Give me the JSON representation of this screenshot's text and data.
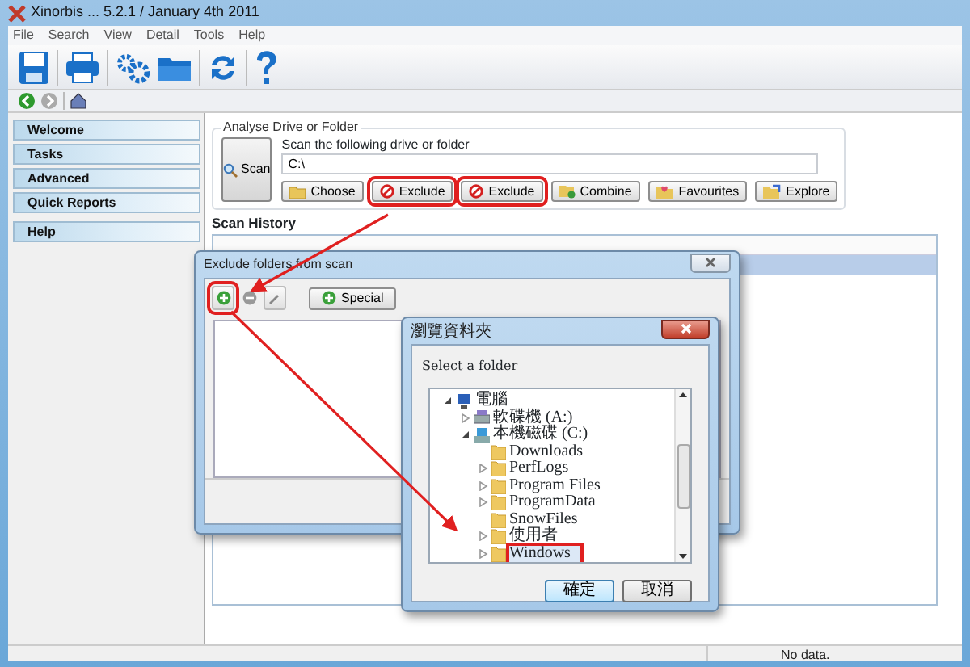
{
  "window": {
    "title": "Xinorbis ... 5.2.1 / January 4th 2011"
  },
  "menu": [
    {
      "label": "File"
    },
    {
      "label": "Search"
    },
    {
      "label": "View"
    },
    {
      "label": "Detail"
    },
    {
      "label": "Tools"
    },
    {
      "label": "Help"
    }
  ],
  "sidebar": {
    "items": [
      {
        "label": "Welcome"
      },
      {
        "label": "Tasks"
      },
      {
        "label": "Advanced"
      },
      {
        "label": "Quick Reports"
      },
      {
        "label": "Help"
      }
    ]
  },
  "analyse": {
    "title": "Analyse Drive or Folder",
    "scan_button": "Scan",
    "path_label": "Scan the following drive or folder",
    "path_value": "C:\\",
    "buttons": [
      {
        "label": "Choose",
        "kind": "folder",
        "highlighted": false
      },
      {
        "label": "Exclude",
        "kind": "exclude",
        "highlighted": true
      },
      {
        "label": "Exclude",
        "kind": "exclude",
        "highlighted": true
      },
      {
        "label": "Combine",
        "kind": "combine",
        "highlighted": false
      },
      {
        "label": "Favourites",
        "kind": "favourites",
        "highlighted": false
      },
      {
        "label": "Explore",
        "kind": "explore",
        "highlighted": false
      }
    ]
  },
  "scan_history": {
    "title": "Scan History"
  },
  "exclude_dialog": {
    "title": "Exclude folders from scan",
    "add_highlighted": true,
    "special_button": "Special"
  },
  "folder_dialog": {
    "title": "瀏覽資料夾",
    "prompt": "Select a folder",
    "tree": [
      {
        "label": "電腦",
        "kind": "computer",
        "expandable": true,
        "expanded": true,
        "selected": false,
        "children": [
          {
            "label": "軟碟機 (A:)",
            "kind": "floppy",
            "expandable": true,
            "expanded": false,
            "selected": false
          },
          {
            "label": "本機磁碟 (C:)",
            "kind": "disk",
            "expandable": true,
            "expanded": true,
            "selected": false,
            "children": [
              {
                "label": "Downloads",
                "kind": "folder",
                "expandable": false,
                "expanded": false,
                "selected": false
              },
              {
                "label": "PerfLogs",
                "kind": "folder",
                "expandable": true,
                "expanded": false,
                "selected": false
              },
              {
                "label": "Program Files",
                "kind": "folder",
                "expandable": true,
                "expanded": false,
                "selected": false
              },
              {
                "label": "ProgramData",
                "kind": "folder",
                "expandable": true,
                "expanded": false,
                "selected": false
              },
              {
                "label": "SnowFiles",
                "kind": "folder",
                "expandable": false,
                "expanded": false,
                "selected": false
              },
              {
                "label": "使用者",
                "kind": "folder",
                "expandable": true,
                "expanded": false,
                "selected": false
              },
              {
                "label": "Windows",
                "kind": "folder",
                "expandable": true,
                "expanded": false,
                "selected": true
              }
            ]
          }
        ]
      }
    ],
    "ok_button": "確定",
    "cancel_button": "取消"
  },
  "status_bar": {
    "text": "No data."
  }
}
